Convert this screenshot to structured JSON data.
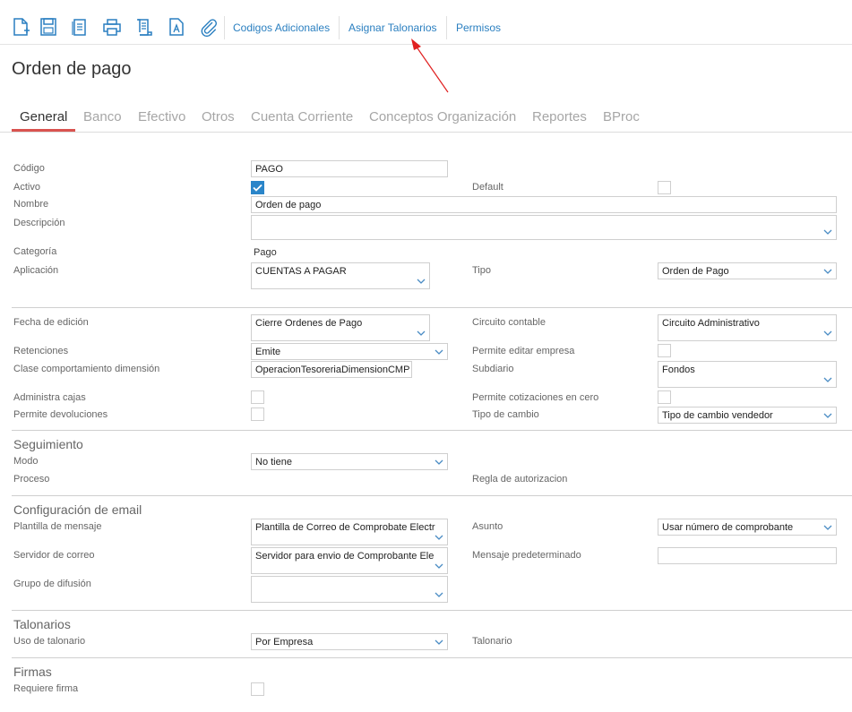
{
  "toolbar": {
    "icons": [
      "new-document-icon",
      "save-icon",
      "copy-icon",
      "print-icon",
      "script-icon",
      "text-document-icon",
      "attachment-icon"
    ],
    "links": [
      "Codigos Adicionales",
      "Asignar Talonarios",
      "Permisos"
    ]
  },
  "page_title": "Orden de pago",
  "tabs": [
    "General",
    "Banco",
    "Efectivo",
    "Otros",
    "Cuenta Corriente",
    "Conceptos Organización",
    "Reportes",
    "BProc"
  ],
  "form": {
    "codigo": {
      "label": "Código",
      "value": "PAGO"
    },
    "activo": {
      "label": "Activo",
      "checked": true
    },
    "default": {
      "label": "Default",
      "checked": false
    },
    "nombre": {
      "label": "Nombre",
      "value": "Orden de pago"
    },
    "descripcion": {
      "label": "Descripción",
      "value": ""
    },
    "categoria": {
      "label": "Categoría",
      "value": "Pago"
    },
    "aplicacion": {
      "label": "Aplicación",
      "value": "CUENTAS A PAGAR"
    },
    "tipo": {
      "label": "Tipo",
      "value": "Orden de Pago"
    },
    "fecha_edicion": {
      "label": "Fecha de edición",
      "value": "Cierre Ordenes de Pago"
    },
    "circuito_contable": {
      "label": "Circuito contable",
      "value": "Circuito Administrativo"
    },
    "retenciones": {
      "label": "Retenciones",
      "value": "Emite"
    },
    "permite_editar_empresa": {
      "label": "Permite editar empresa",
      "checked": false
    },
    "clase_comportamiento": {
      "label": "Clase comportamiento dimensión",
      "value": "OperacionTesoreriaDimensionCMP"
    },
    "subdiario": {
      "label": "Subdiario",
      "value": "Fondos"
    },
    "administra_cajas": {
      "label": "Administra cajas",
      "checked": false
    },
    "permite_cotizaciones": {
      "label": "Permite cotizaciones en cero",
      "checked": false
    },
    "permite_devoluciones": {
      "label": "Permite devoluciones",
      "checked": false
    },
    "tipo_cambio": {
      "label": "Tipo de cambio",
      "value": "Tipo de cambio vendedor"
    }
  },
  "seguimiento": {
    "title": "Seguimiento",
    "modo": {
      "label": "Modo",
      "value": "No tiene"
    },
    "proceso": {
      "label": "Proceso"
    },
    "regla": {
      "label": "Regla de autorizacion"
    }
  },
  "email": {
    "title": "Configuración de email",
    "plantilla": {
      "label": "Plantilla de mensaje",
      "value": "Plantilla de Correo de Comprobate Electr"
    },
    "asunto": {
      "label": "Asunto",
      "value": "Usar número de comprobante"
    },
    "servidor": {
      "label": "Servidor de correo",
      "value": "Servidor para envio de Comprobante Ele"
    },
    "mensaje": {
      "label": "Mensaje predeterminado",
      "value": ""
    },
    "grupo": {
      "label": "Grupo de difusión",
      "value": ""
    }
  },
  "talonarios": {
    "title": "Talonarios",
    "uso": {
      "label": "Uso de talonario",
      "value": "Por Empresa"
    },
    "talonario": {
      "label": "Talonario"
    }
  },
  "firmas": {
    "title": "Firmas",
    "requiere": {
      "label": "Requiere firma",
      "checked": false
    }
  },
  "colors": {
    "accent": "#2a7fc0",
    "tab_underline": "#d9534f",
    "annotation_arrow": "#e02020",
    "checkbox_checked": "#2a85c9"
  }
}
